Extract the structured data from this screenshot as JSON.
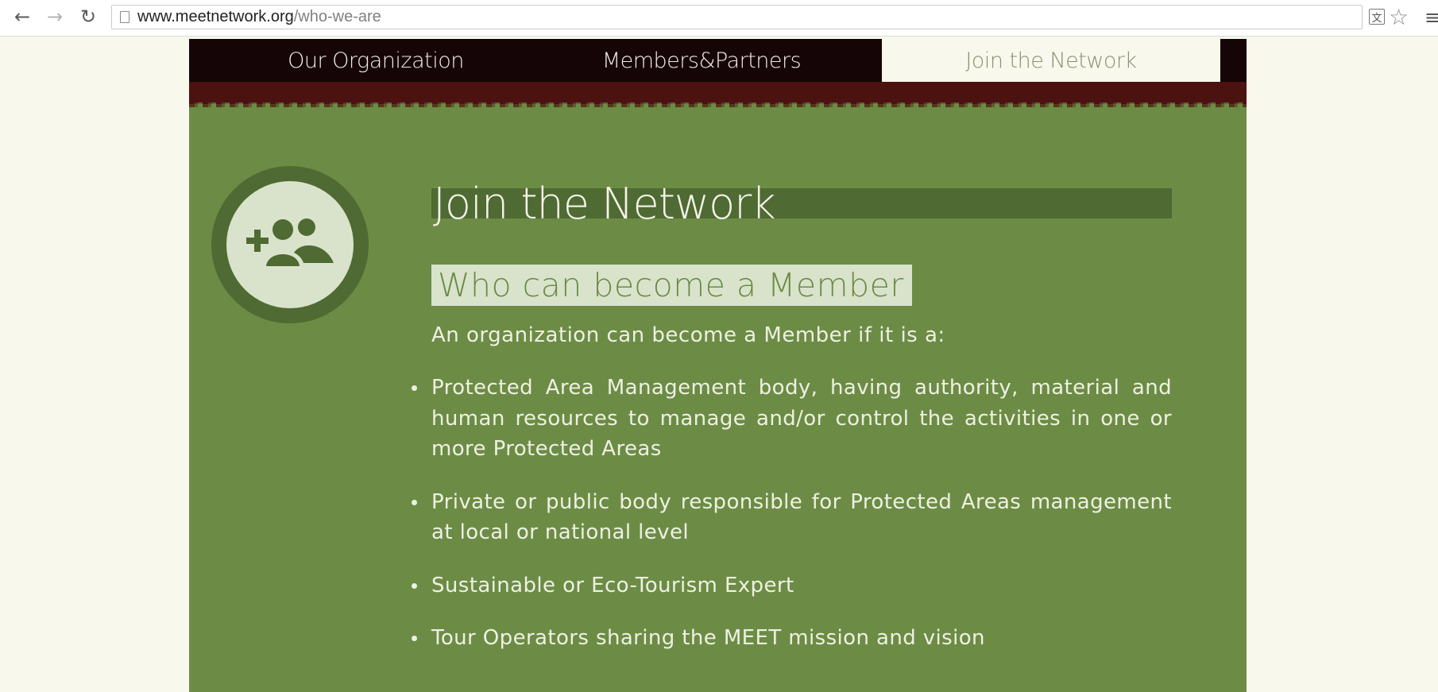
{
  "browser": {
    "url_host": "www.meetnetwork.org",
    "url_path": "/who-we-are",
    "icons": [
      "back-arrow-icon",
      "forward-arrow-icon",
      "reload-icon",
      "page-icon",
      "translate-icon",
      "star-icon",
      "menu-icon"
    ]
  },
  "nav": {
    "items": [
      {
        "label": "Our Organization",
        "active": false
      },
      {
        "label": "Members&Partners",
        "active": false
      },
      {
        "label": "Join the Network",
        "active": true
      }
    ]
  },
  "main": {
    "icon": "add-group-icon",
    "title": "Join the Network",
    "subtitle": "Who can become a Member",
    "intro": "An organization can become a Member if it is a:",
    "criteria": [
      "Protected Area Management body, having authority, material and human resources to manage and/or control the activities in one or more Protected Areas",
      "Private or public body responsible for Protected Areas management at local or national level",
      "Sustainable or Eco-Tourism Expert",
      "Tour Operators sharing the MEET mission and vision"
    ]
  },
  "colors": {
    "page_bg": "#f8f8ec",
    "content_green": "#6c8c45",
    "dark_green": "#4f6a32",
    "pale_green": "#d9e3cc",
    "nav_bg": "#160507",
    "band_red": "#4b1210"
  }
}
